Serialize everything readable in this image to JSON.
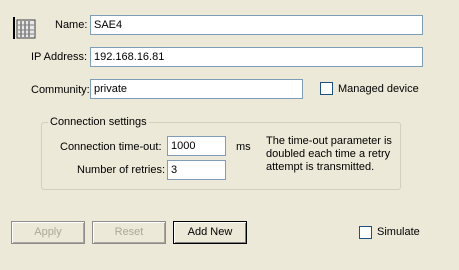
{
  "device": {
    "name_label": "Name:",
    "name_value": "SAE4",
    "ip_label": "IP Address:",
    "ip_value": "192.168.16.81",
    "community_label": "Community:",
    "community_value": "private",
    "managed_label": "Managed device",
    "managed_checked": false
  },
  "connection": {
    "group_title": "Connection settings",
    "timeout_label": "Connection time-out:",
    "timeout_value": "1000",
    "timeout_unit": "ms",
    "retries_label": "Number of retries:",
    "retries_value": "3",
    "note_line1": "The time-out parameter is",
    "note_line2": "doubled each time a retry",
    "note_line3": "attempt is transmitted."
  },
  "buttons": {
    "apply": "Apply",
    "reset": "Reset",
    "add_new": "Add New"
  },
  "simulate": {
    "label": "Simulate",
    "checked": false
  },
  "icons": {
    "device_icon": "server-rack-icon"
  }
}
